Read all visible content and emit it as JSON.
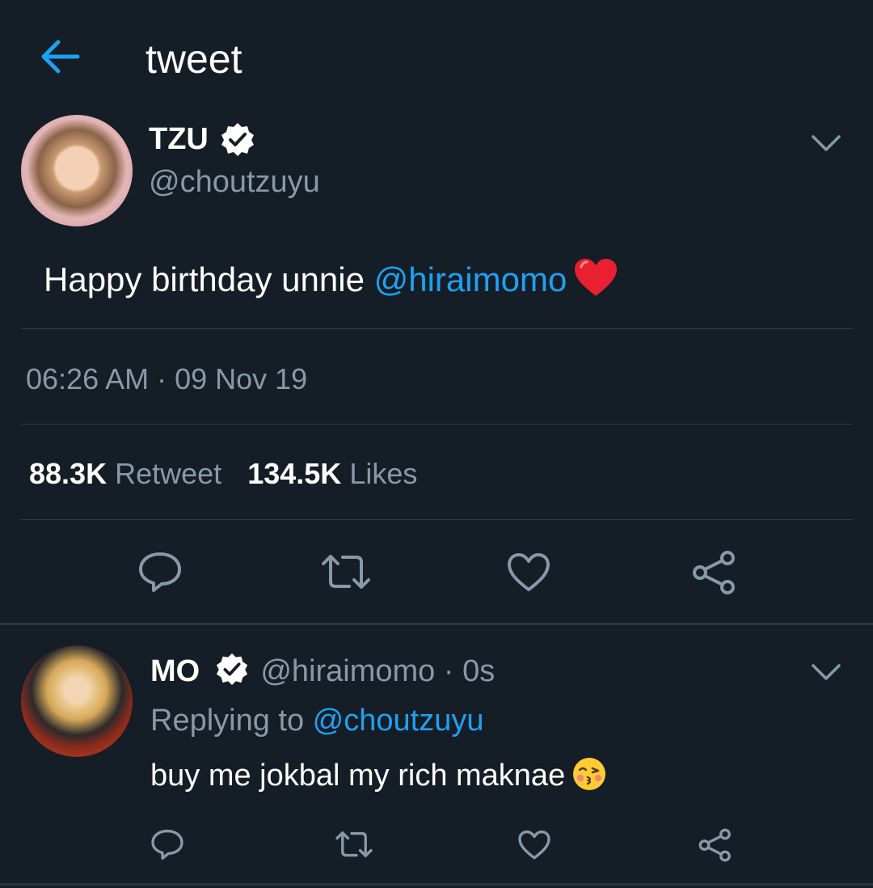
{
  "header": {
    "title": "tweet",
    "back_icon": "arrow-left-icon",
    "accent_color": "#1da1f2"
  },
  "tweet": {
    "author_name": "TZU",
    "author_handle": "@choutzuyu",
    "verified_icon": "verified-badge-icon",
    "text_before": "Happy birthday unnie ",
    "mention": "@hiraimomo",
    "emoji": "red-heart-emoji",
    "timestamp": "06:26 AM · 09 Nov 19",
    "retweet_count": "88.3K",
    "retweet_label": "Retweet",
    "like_count": "134.5K",
    "like_label": "Likes",
    "actions": [
      "reply-icon",
      "retweet-icon",
      "like-icon",
      "share-icon"
    ]
  },
  "reply": {
    "author_name": "MO",
    "author_handle": "@hiraimomo",
    "separator": "·",
    "time": "0s",
    "replying_prefix": "Replying to ",
    "replying_to": "@choutzuyu",
    "text": "buy me jokbal my rich maknae",
    "emoji": "kissing-face-emoji",
    "actions": [
      "reply-icon",
      "retweet-icon",
      "like-icon",
      "share-icon"
    ]
  },
  "colors": {
    "background": "#151d26",
    "muted_text": "#8899a6",
    "divider": "#2f3b47"
  }
}
